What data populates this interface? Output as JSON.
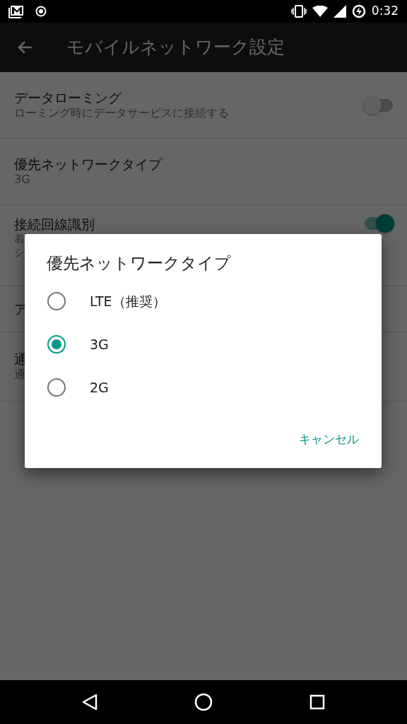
{
  "status_bar": {
    "time": "0:32"
  },
  "app_bar": {
    "title": "モバイルネットワーク設定"
  },
  "settings": [
    {
      "kind": "switch",
      "title": "データローミング",
      "summary": [
        "ローミング時にデータサービスに接続する"
      ],
      "on": false
    },
    {
      "kind": "plain",
      "title": "優先ネットワークタイプ",
      "summary": [
        "3G"
      ]
    },
    {
      "kind": "switch",
      "title": "接続回線識別",
      "summary": [
        "着",
        "シ"
      ],
      "on": true
    },
    {
      "kind": "plain",
      "title": "ア"
    },
    {
      "kind": "plain",
      "title": "通",
      "summary": [
        "通"
      ]
    }
  ],
  "dialog": {
    "title": "優先ネットワークタイプ",
    "options": [
      {
        "label": "LTE（推奨）",
        "selected": false
      },
      {
        "label": "3G",
        "selected": true
      },
      {
        "label": "2G",
        "selected": false
      }
    ],
    "buttons": [
      "キャンセル"
    ]
  }
}
